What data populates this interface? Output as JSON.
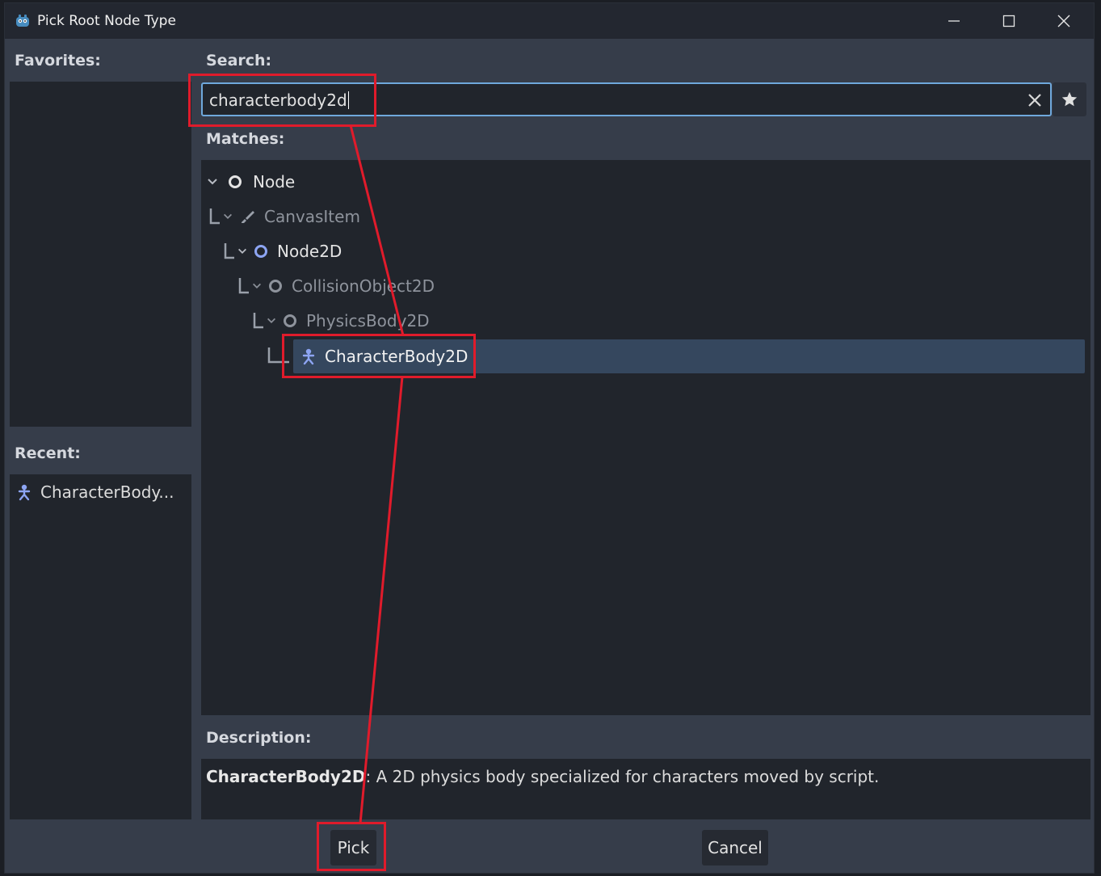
{
  "window": {
    "title": "Pick Root Node Type",
    "minimize_icon": "minimize-icon",
    "maximize_icon": "maximize-icon",
    "close_icon": "close-icon"
  },
  "favorites": {
    "label": "Favorites:"
  },
  "recent": {
    "label": "Recent:",
    "items": [
      {
        "label": "CharacterBody...",
        "icon": "character-body-icon"
      }
    ]
  },
  "search": {
    "label": "Search:",
    "value": "characterbody2d",
    "clear_icon": "clear-icon",
    "favorite_icon": "star-icon"
  },
  "matches": {
    "label": "Matches:",
    "tree": [
      {
        "label": "Node",
        "icon": "node-circle-icon",
        "depth": 0,
        "dimmed": false,
        "selected": false
      },
      {
        "label": "CanvasItem",
        "icon": "brush-icon",
        "depth": 1,
        "dimmed": true,
        "selected": false
      },
      {
        "label": "Node2D",
        "icon": "node2d-circle-icon",
        "depth": 2,
        "dimmed": false,
        "selected": false
      },
      {
        "label": "CollisionObject2D",
        "icon": "collision-object-icon",
        "depth": 3,
        "dimmed": true,
        "selected": false
      },
      {
        "label": "PhysicsBody2D",
        "icon": "physics-body-icon",
        "depth": 4,
        "dimmed": true,
        "selected": false
      },
      {
        "label": "CharacterBody2D",
        "icon": "character-body-icon",
        "depth": 5,
        "dimmed": false,
        "selected": true
      }
    ]
  },
  "description": {
    "label": "Description:",
    "class_name": "CharacterBody2D",
    "text": ": A 2D physics body specialized for characters moved by script."
  },
  "buttons": {
    "pick": "Pick",
    "cancel": "Cancel"
  },
  "colors": {
    "accent_blue": "#6fa8dc",
    "node2d_blue": "#8da5f3",
    "annotation_red": "#e01b2b",
    "selection": "#35475e"
  }
}
